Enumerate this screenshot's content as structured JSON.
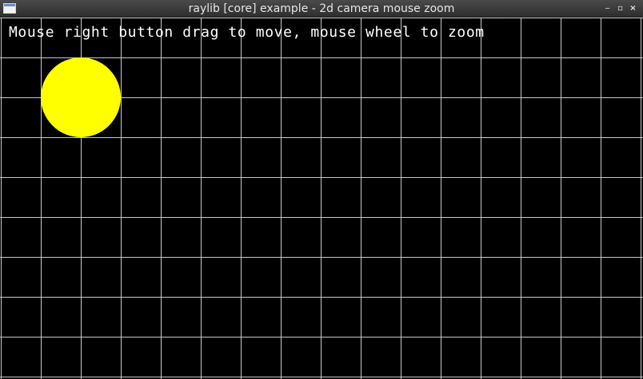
{
  "window": {
    "title": "raylib [core] example - 2d camera mouse zoom",
    "buttons": {
      "minimize": "‒",
      "maximize": "▫",
      "close": "×"
    }
  },
  "canvas": {
    "background_color": "#000000",
    "grid_color": "#c8c8c8",
    "circle_color": "#ffff00",
    "instructions": "Mouse right button drag to move, mouse wheel to zoom"
  }
}
